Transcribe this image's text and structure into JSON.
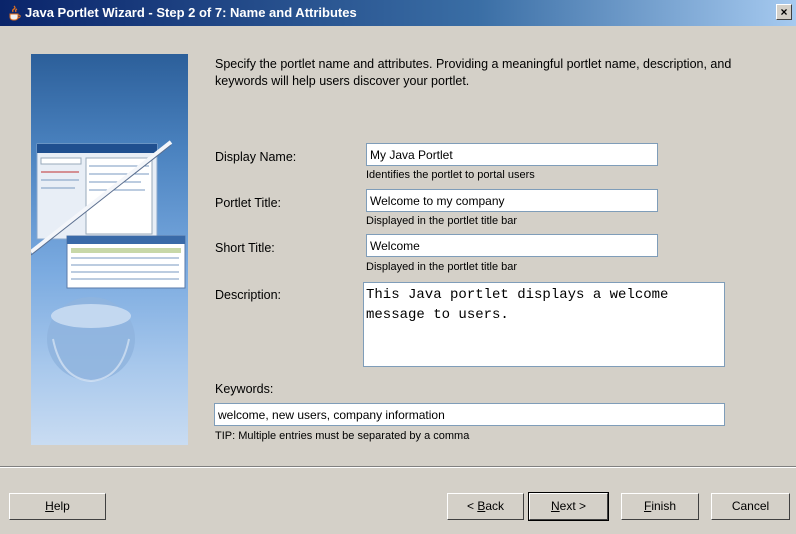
{
  "window": {
    "title": "Java Portlet Wizard - Step 2 of 7: Name and Attributes",
    "close_label": "×"
  },
  "intro": {
    "text": "Specify the portlet name and attributes. Providing a meaningful portlet name, description, and keywords will help users discover your portlet."
  },
  "form": {
    "display_name": {
      "label": "Display Name:",
      "value": "My Java Portlet",
      "hint": "Identifies the portlet to portal users"
    },
    "portlet_title": {
      "label": "Portlet Title:",
      "value": "Welcome to my company",
      "hint": "Displayed in the portlet title bar"
    },
    "short_title": {
      "label": "Short Title:",
      "value": "Welcome",
      "hint": "Displayed in the portlet title bar"
    },
    "description": {
      "label": "Description:",
      "value": "This Java portlet displays a welcome message to users."
    },
    "keywords": {
      "label": "Keywords:",
      "value": "welcome, new users, company information",
      "hint": "TIP: Multiple entries must be separated by a comma"
    }
  },
  "buttons": {
    "help": {
      "pre": "",
      "key": "H",
      "post": "elp"
    },
    "back": {
      "pre": "< ",
      "key": "B",
      "post": "ack"
    },
    "next": {
      "pre": "",
      "key": "N",
      "post": "ext >"
    },
    "finish": {
      "pre": "",
      "key": "F",
      "post": "inish"
    },
    "cancel": {
      "pre": "",
      "key": "",
      "post": "Cancel"
    }
  },
  "colors": {
    "titlebar_start": "#0a246a",
    "titlebar_end": "#a6caf0",
    "dialog_bg": "#d4d0c8",
    "banner_blue": "#4b83c0"
  }
}
